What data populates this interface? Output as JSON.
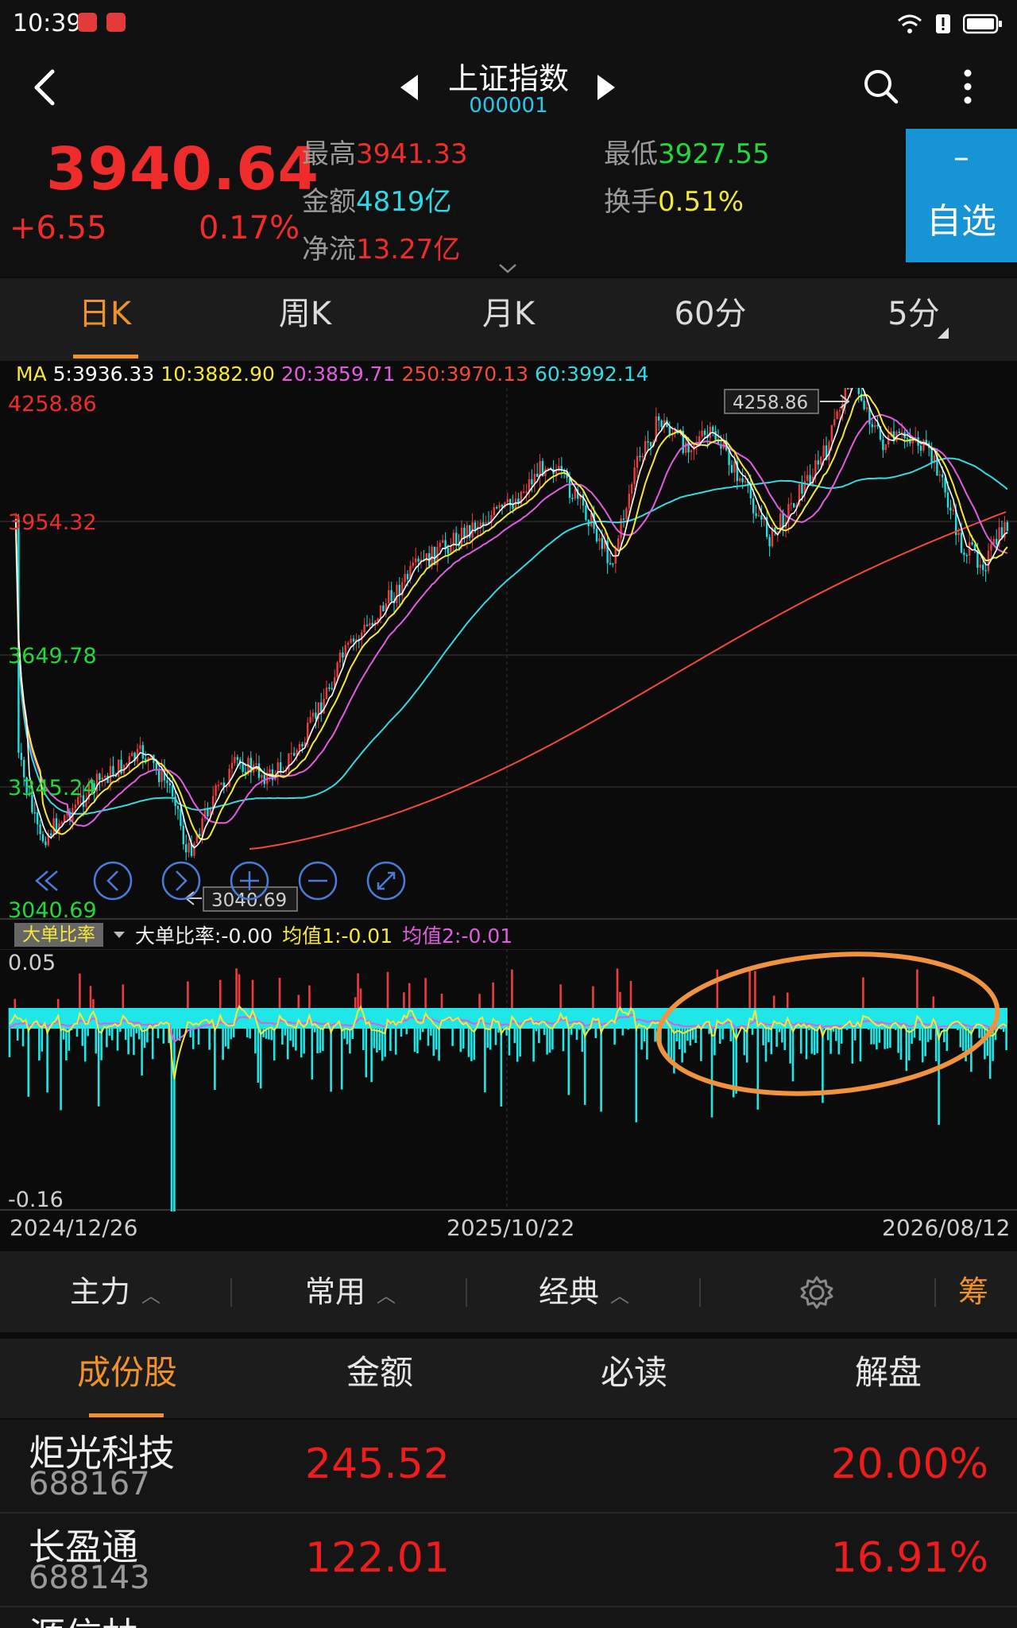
{
  "status_bar": {
    "time": "10:39"
  },
  "nav": {
    "title": "上证指数",
    "code": "000001"
  },
  "quote": {
    "price": "3940.64",
    "change": "+6.55",
    "change_pct": "0.17%",
    "high_label": "最高",
    "high_value": "3941.33",
    "low_label": "最低",
    "low_value": "3927.55",
    "amount_label": "金额",
    "amount_value": "4819亿",
    "turnover_label": "换手",
    "turnover_value": "0.51%",
    "netflow_label": "净流",
    "netflow_value": "13.27亿",
    "watch_minus": "–",
    "watch_label": "自选"
  },
  "period_tabs": [
    "日K",
    "周K",
    "月K",
    "60分",
    "5分"
  ],
  "ma": {
    "prefix": "MA",
    "items": [
      {
        "text": "5:3936.33",
        "color": "#ffffff"
      },
      {
        "text": "10:3882.90",
        "color": "#f5e83a"
      },
      {
        "text": "20:3859.71",
        "color": "#e05de0"
      },
      {
        "text": "250:3970.13",
        "color": "#f04b3b"
      },
      {
        "text": "60:3992.14",
        "color": "#37d9e0"
      }
    ]
  },
  "kline": {
    "axis_labels": [
      "4258.86",
      "3954.32",
      "3649.78",
      "3345.24",
      "3040.69"
    ],
    "high_marker": "4258.86",
    "low_marker": "3040.69"
  },
  "indicator": {
    "name": "大单比率",
    "value_text": "大单比率:-0.00",
    "avg1_text": "均值1:-0.01",
    "avg2_text": "均值2:-0.01",
    "top_label": "0.05",
    "bottom_label": "-0.16"
  },
  "dates": [
    "2024/12/26",
    "2025/10/22",
    "2026/08/12"
  ],
  "toolbar": {
    "main": "主力",
    "common": "常用",
    "classic": "经典",
    "chip": "筹"
  },
  "list_tabs": [
    "成份股",
    "金额",
    "必读",
    "解盘"
  ],
  "stocks": [
    {
      "name": "炬光科技",
      "code": "688167",
      "amount": "245.52",
      "pct": "20.00%"
    },
    {
      "name": "长盈通",
      "code": "688143",
      "amount": "122.01",
      "pct": "16.91%"
    },
    {
      "name": "源信林",
      "code": "",
      "amount": "",
      "pct": ""
    }
  ],
  "colors": {
    "up": "#ee2c2c",
    "down": "#21e0e0",
    "accent": "#f0922c",
    "watch": "#1794d6"
  }
}
